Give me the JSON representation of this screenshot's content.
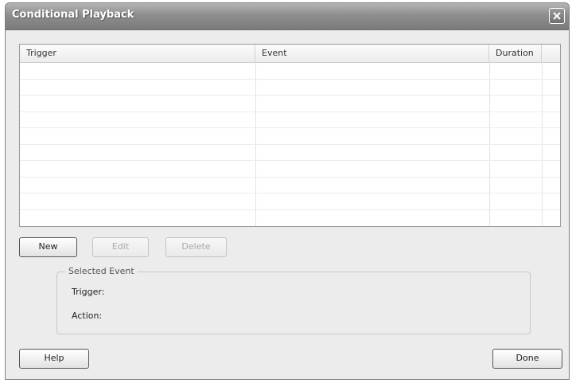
{
  "window": {
    "title": "Conditional Playback"
  },
  "table": {
    "columns": [
      "Trigger",
      "Event",
      "Duration"
    ],
    "rows": []
  },
  "buttons": {
    "new_label": "New",
    "edit_label": "Edit",
    "delete_label": "Delete",
    "help_label": "Help",
    "done_label": "Done"
  },
  "selected_event": {
    "legend": "Selected Event",
    "trigger_label": "Trigger:",
    "action_label": "Action:"
  }
}
